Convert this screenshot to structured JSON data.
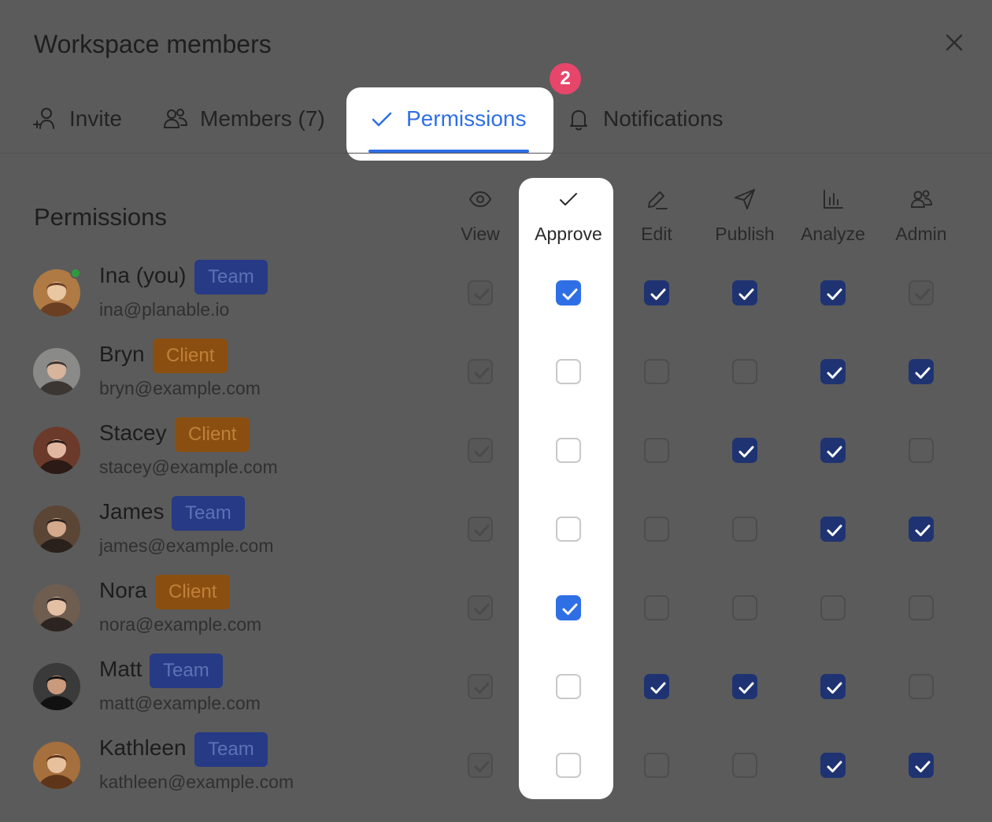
{
  "modal": {
    "title": "Workspace members"
  },
  "tabs": [
    {
      "label": "Invite",
      "icon": "user-plus-icon"
    },
    {
      "label": "Members (7)",
      "icon": "users-icon"
    },
    {
      "label": "Permissions",
      "icon": "check-icon",
      "active": true
    },
    {
      "label": "Notifications",
      "icon": "bell-icon"
    }
  ],
  "step_badge": "2",
  "section_title": "Permissions",
  "columns": [
    {
      "label": "View",
      "icon": "eye-icon"
    },
    {
      "label": "Approve",
      "icon": "check-icon",
      "highlighted": true
    },
    {
      "label": "Edit",
      "icon": "pencil-icon"
    },
    {
      "label": "Publish",
      "icon": "send-icon"
    },
    {
      "label": "Analyze",
      "icon": "bar-chart-icon"
    },
    {
      "label": "Admin",
      "icon": "users-icon"
    }
  ],
  "members": [
    {
      "name": "Ina (you)",
      "role": "Team",
      "email": "ina@planable.io",
      "online": true,
      "permissions": {
        "view": true,
        "approve": true,
        "edit": true,
        "publish": true,
        "analyze": true,
        "admin": true
      }
    },
    {
      "name": "Bryn",
      "role": "Client",
      "email": "bryn@example.com",
      "online": false,
      "permissions": {
        "view": true,
        "approve": false,
        "edit": false,
        "publish": false,
        "analyze": true,
        "admin": true
      }
    },
    {
      "name": "Stacey",
      "role": "Client",
      "email": "stacey@example.com",
      "online": false,
      "permissions": {
        "view": true,
        "approve": false,
        "edit": false,
        "publish": true,
        "analyze": true,
        "admin": false
      }
    },
    {
      "name": "James",
      "role": "Team",
      "email": "james@example.com",
      "online": false,
      "permissions": {
        "view": true,
        "approve": false,
        "edit": false,
        "publish": false,
        "analyze": true,
        "admin": true
      }
    },
    {
      "name": "Nora",
      "role": "Client",
      "email": "nora@example.com",
      "online": false,
      "permissions": {
        "view": true,
        "approve": true,
        "edit": false,
        "publish": false,
        "analyze": false,
        "admin": false
      }
    },
    {
      "name": "Matt",
      "role": "Team",
      "email": "matt@example.com",
      "online": false,
      "permissions": {
        "view": true,
        "approve": false,
        "edit": true,
        "publish": true,
        "analyze": true,
        "admin": false
      }
    },
    {
      "name": "Kathleen",
      "role": "Team",
      "email": "kathleen@example.com",
      "online": false,
      "permissions": {
        "view": true,
        "approve": false,
        "edit": false,
        "publish": false,
        "analyze": true,
        "admin": true
      }
    }
  ],
  "colors": {
    "accent": "#2f6fe6",
    "badge_pink": "#e8456b",
    "team_badge": "#263a85",
    "client_badge": "#8a4f10",
    "checked_dimmed": "#1f3372"
  }
}
